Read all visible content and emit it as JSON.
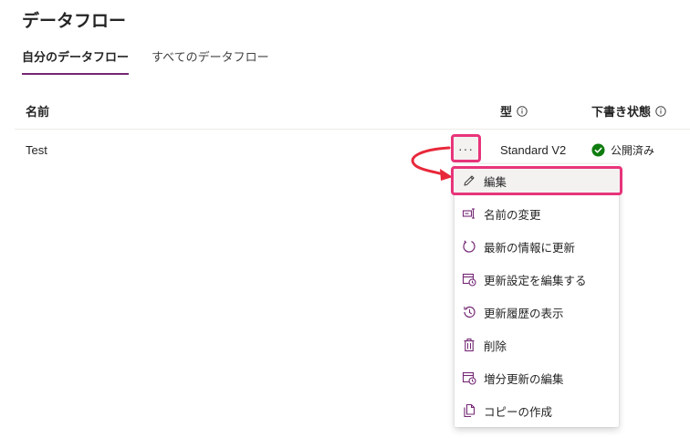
{
  "page": {
    "title": "データフロー"
  },
  "tabs": [
    {
      "label": "自分のデータフロー",
      "active": true
    },
    {
      "label": "すべてのデータフロー",
      "active": false
    }
  ],
  "table": {
    "headers": {
      "name": "名前",
      "type": "型",
      "status": "下書き状態"
    },
    "rows": [
      {
        "name": "Test",
        "type": "Standard V2",
        "status": "公開済み"
      }
    ]
  },
  "more_button": {
    "label": "···"
  },
  "context_menu": {
    "items": [
      {
        "label": "編集",
        "icon": "pencil-icon",
        "highlighted": true
      },
      {
        "label": "名前の変更",
        "icon": "rename-icon"
      },
      {
        "label": "最新の情報に更新",
        "icon": "refresh-icon"
      },
      {
        "label": "更新設定を編集する",
        "icon": "calendar-clock-icon"
      },
      {
        "label": "更新履歴の表示",
        "icon": "history-icon"
      },
      {
        "label": "削除",
        "icon": "trash-icon"
      },
      {
        "label": "増分更新の編集",
        "icon": "calendar-clock-icon"
      },
      {
        "label": "コピーの作成",
        "icon": "copy-icon"
      }
    ]
  },
  "colors": {
    "accent": "#742774",
    "highlight_border": "#e8347a",
    "success": "#107c10",
    "arrow": "#e8283a"
  }
}
